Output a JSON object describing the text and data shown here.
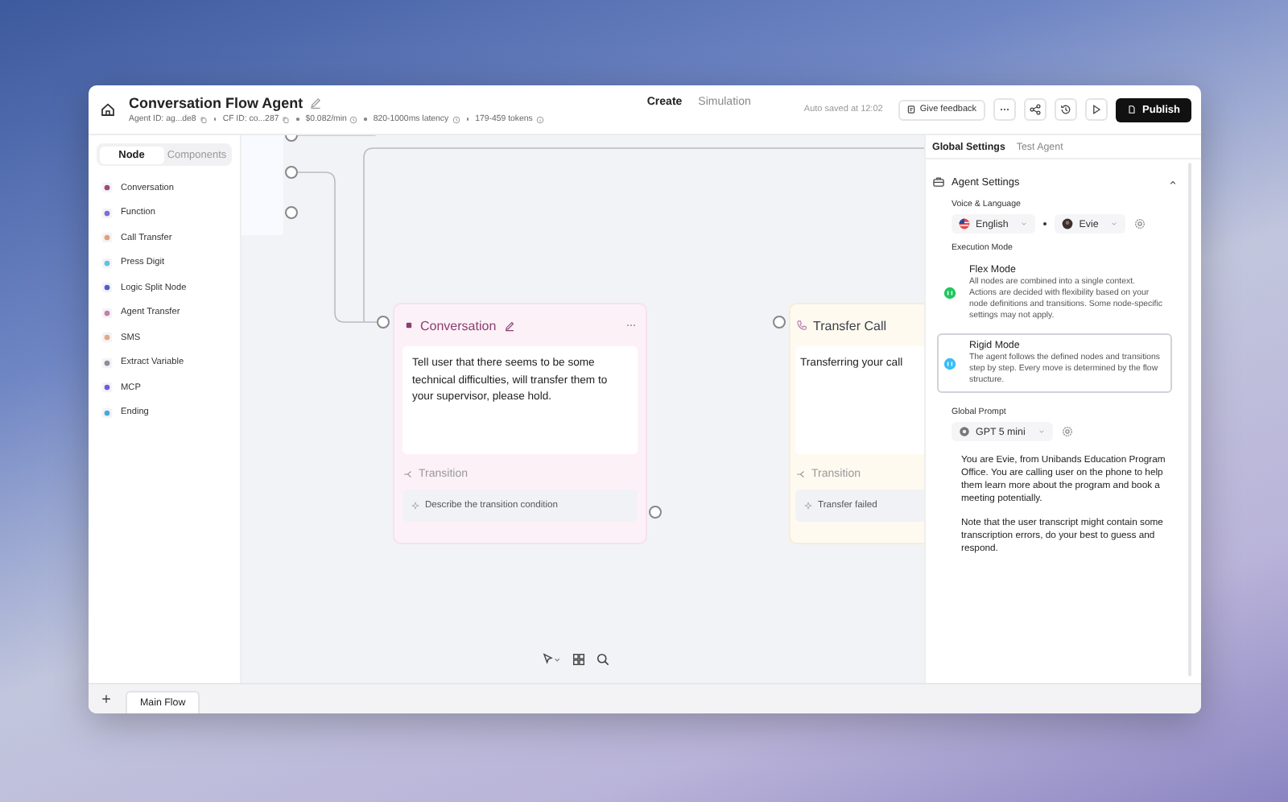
{
  "header": {
    "title": "Conversation Flow Agent",
    "meta": [
      {
        "text": "Agent ID: ag...de8",
        "kind": "copy"
      },
      {
        "text": "CF ID: co...287",
        "kind": "copy"
      },
      {
        "text": "$0.082/min",
        "kind": "time"
      },
      {
        "text": "820-1000ms latency",
        "kind": "time"
      },
      {
        "text": "179-459 tokens",
        "kind": "info"
      }
    ],
    "tabs": [
      {
        "label": "Create",
        "selected": true
      },
      {
        "label": "Simulation",
        "selected": false
      }
    ],
    "autosave": "Auto saved at 12:02",
    "feedback_button": "Give feedback",
    "publish_button": "Publish"
  },
  "sidebar": {
    "tabs": [
      {
        "label": "Node",
        "selected": true
      },
      {
        "label": "Components",
        "selected": false
      }
    ],
    "items": [
      {
        "label": "Conversation",
        "color": "#9d4b7a"
      },
      {
        "label": "Function",
        "color": "#7c6fd6"
      },
      {
        "label": "Call Transfer",
        "color": "#e0a07a"
      },
      {
        "label": "Press Digit",
        "color": "#5cc4dc"
      },
      {
        "label": "Logic Split Node",
        "color": "#4f5fd0"
      },
      {
        "label": "Agent Transfer",
        "color": "#c47fa8"
      },
      {
        "label": "SMS",
        "color": "#e3a985"
      },
      {
        "label": "Extract Variable",
        "color": "#8a8f98"
      },
      {
        "label": "MCP",
        "color": "#6a5ee0"
      },
      {
        "label": "Ending",
        "color": "#4aa8dc"
      }
    ]
  },
  "canvas": {
    "nodes": [
      {
        "kind": "conversation",
        "title": "Conversation",
        "color": "#8a3f6e",
        "text": "Tell user that there seems to be some technical difficulties, will transfer them to your supervisor, please hold.",
        "transition_label": "Transition",
        "conditions": [
          "Describe the transition condition"
        ]
      },
      {
        "kind": "transfer",
        "title": "Transfer Call",
        "color": "#3b3f46",
        "text": "Transferring your call",
        "transition_label": "Transition",
        "conditions": [
          "Transfer failed"
        ]
      }
    ]
  },
  "panel": {
    "tabs": [
      {
        "label": "Global Settings",
        "selected": true
      },
      {
        "label": "Test Agent",
        "selected": false
      }
    ],
    "section": {
      "title": "Agent Settings",
      "expanded": true,
      "voice_label": "Voice & Language",
      "language": "English",
      "voice": "Evie",
      "mode_label": "Execution Mode",
      "modes": [
        {
          "title": "Flex Mode",
          "description": "All nodes are combined into a single context. Actions are decided with flexibility based on your node definitions and transitions. Some node-specific settings may not apply.",
          "selected": false,
          "color": "#22c55e"
        },
        {
          "title": "Rigid Mode",
          "description": "The agent follows the defined nodes and transitions step by step. Every move is determined by the flow structure.",
          "selected": true,
          "color": "#38bdf8"
        }
      ],
      "prompt_label": "Global Prompt",
      "model": "GPT 5 mini",
      "prompt": [
        "You are Evie, from Unibands Education Program Office. You are calling user on the phone to help them learn more about the program and book a meeting potentially.",
        "Note that the user transcript might contain some transcription errors, do your best to guess and respond."
      ]
    }
  },
  "footer": {
    "tabs": [
      {
        "label": "Main Flow",
        "selected": true
      }
    ]
  }
}
